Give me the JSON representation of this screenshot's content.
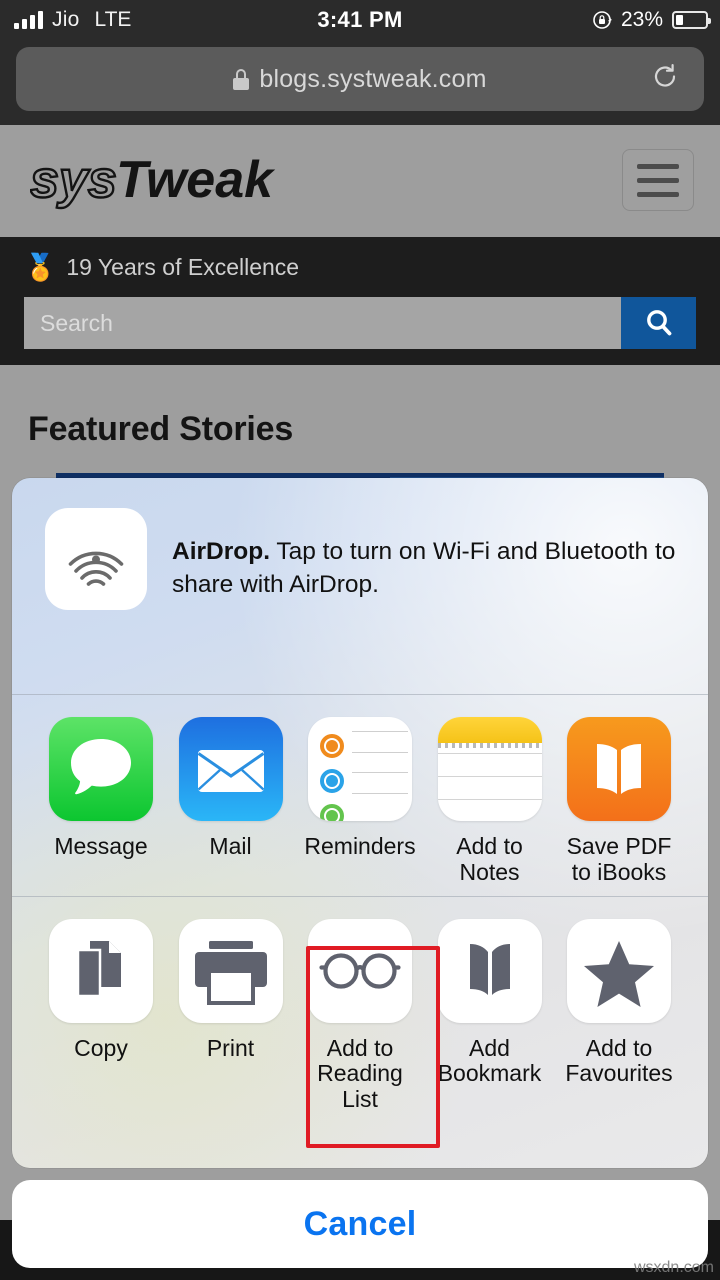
{
  "status_bar": {
    "carrier": "Jio",
    "network": "LTE",
    "time": "3:41 PM",
    "battery_percent": "23%",
    "battery_level": 23,
    "rotation_lock_icon": "rotation-lock-icon",
    "signal_icon": "signal-bars-icon"
  },
  "browser": {
    "lock_icon": "lock-icon",
    "url": "blogs.systweak.com",
    "reload_icon": "reload-icon"
  },
  "site": {
    "logo_text_light": "sys",
    "logo_text_bold": "Tweak",
    "menu_icon": "hamburger-menu-icon",
    "badge_icon": "medal-emoji",
    "tagline": "19 Years of Excellence",
    "search_placeholder": "Search",
    "search_value": "",
    "search_button_icon": "search-icon",
    "search_button_color": "#10569b",
    "featured_heading": "Featured Stories"
  },
  "share_sheet": {
    "airdrop": {
      "icon": "airdrop-icon",
      "title": "AirDrop.",
      "description": " Tap to turn on Wi-Fi and Bluetooth to share with AirDrop."
    },
    "apps": [
      {
        "label": "Message",
        "icon": "messages-app-icon"
      },
      {
        "label": "Mail",
        "icon": "mail-app-icon"
      },
      {
        "label": "Reminders",
        "icon": "reminders-app-icon"
      },
      {
        "label": "Add to Notes",
        "icon": "notes-app-icon"
      },
      {
        "label": "Save PDF\nto iBooks",
        "icon": "ibooks-app-icon"
      }
    ],
    "actions": [
      {
        "label": "Copy",
        "icon": "copy-icon",
        "highlighted": false
      },
      {
        "label": "Print",
        "icon": "printer-icon",
        "highlighted": false
      },
      {
        "label": "Add to\nReading List",
        "icon": "glasses-icon",
        "highlighted": true
      },
      {
        "label": "Add\nBookmark",
        "icon": "open-book-icon",
        "highlighted": false
      },
      {
        "label": "Add to\nFavourites",
        "icon": "star-icon",
        "highlighted": false
      }
    ],
    "highlight_color": "#e01b24",
    "cancel_label": "Cancel",
    "cancel_color": "#0a74f0"
  },
  "watermark": "wsxdn.com"
}
